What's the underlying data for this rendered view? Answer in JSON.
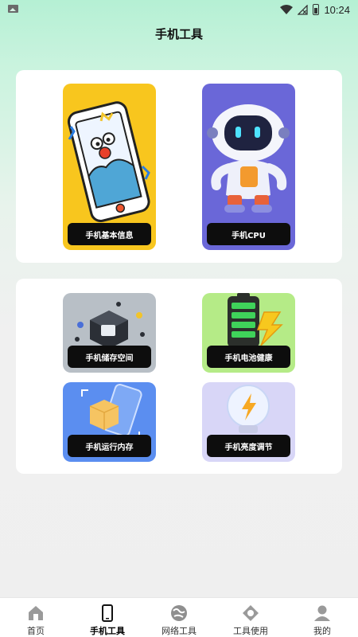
{
  "status_bar": {
    "time": "10:24"
  },
  "header": {
    "title": "手机工具"
  },
  "top_card": {
    "tiles": [
      {
        "label": "手机基本信息",
        "icon": "phone-illustration"
      },
      {
        "label": "手机CPU",
        "icon": "robot-illustration"
      }
    ]
  },
  "bottom_card": {
    "tiles": [
      {
        "label": "手机储存空间",
        "icon": "storage-illustration"
      },
      {
        "label": "手机电池健康",
        "icon": "battery-illustration"
      },
      {
        "label": "手机运行内存",
        "icon": "memory-illustration"
      },
      {
        "label": "手机亮度调节",
        "icon": "lightbulb-illustration"
      }
    ]
  },
  "bottom_nav": {
    "items": [
      {
        "label": "首页",
        "icon": "home-icon",
        "active": false
      },
      {
        "label": "手机工具",
        "icon": "phone-icon",
        "active": true
      },
      {
        "label": "网络工具",
        "icon": "globe-icon",
        "active": false
      },
      {
        "label": "工具使用",
        "icon": "tools-icon",
        "active": false
      },
      {
        "label": "我的",
        "icon": "person-icon",
        "active": false
      }
    ]
  },
  "colors": {
    "basic_tile": "#f8c61e",
    "cpu_tile": "#6a67d8",
    "storage_tile": "#b8bfc6",
    "battery_tile": "#b5eb87",
    "memory_tile": "#5b8ef0",
    "brightness_tile": "#d8d6f7",
    "label_bg": "#0d0d0d"
  }
}
